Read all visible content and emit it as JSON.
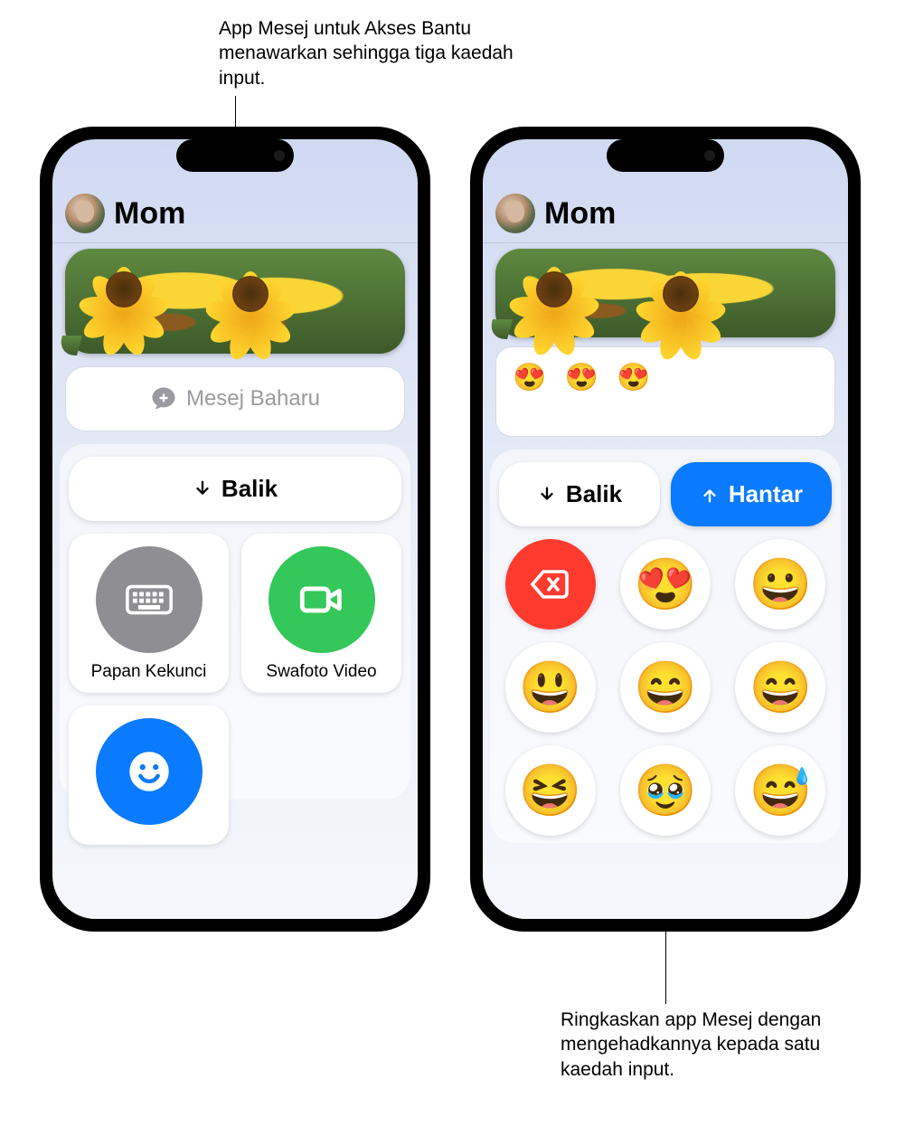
{
  "callouts": {
    "top": "App Mesej untuk Akses Bantu menawarkan sehingga tiga kaedah input.",
    "bottom": "Ringkaskan app Mesej dengan mengehadkannya kepada satu kaedah input."
  },
  "phone1": {
    "contact": "Mom",
    "new_message_placeholder": "Mesej Baharu",
    "back_label": "Balik",
    "methods": {
      "keyboard": "Papan Kekunci",
      "video": "Swafoto Video",
      "emoji": "Emoji"
    }
  },
  "phone2": {
    "contact": "Mom",
    "compose": "😍 😍 😍",
    "back_label": "Balik",
    "send_label": "Hantar",
    "emojis": [
      "delete",
      "😍",
      "😀",
      "😃",
      "😄",
      "😄",
      "😆",
      "🥹",
      "😅"
    ]
  }
}
